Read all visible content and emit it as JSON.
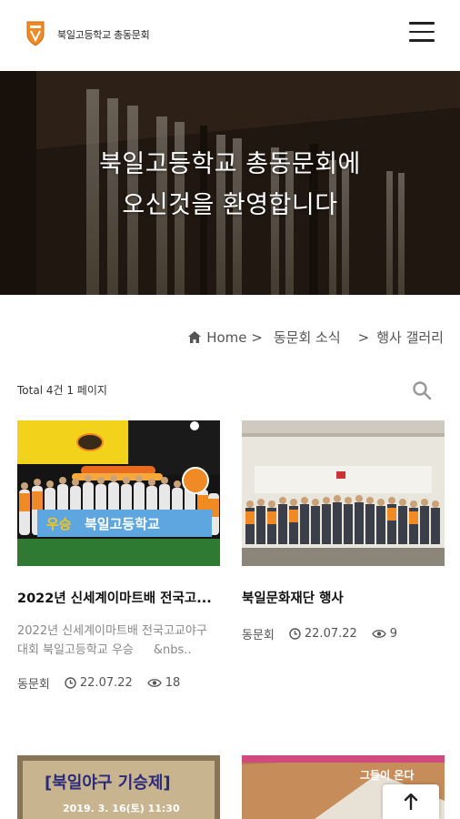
{
  "header": {
    "site_name": "북일고등학교 총동문회",
    "logo": "school-emblem",
    "menu_icon": "hamburger-menu-icon"
  },
  "hero": {
    "line1": "북일고등학교 총동문회에",
    "line2": "오신것을 환영합니다"
  },
  "breadcrumb": {
    "home": "Home >",
    "level1": "동문회 소식",
    "separator": ">",
    "level2": "행사 갤러리"
  },
  "list_info": {
    "total": "Total 4건 1 페이지"
  },
  "posts": [
    {
      "title": "2022년 신세계이마트배 전국고...",
      "excerpt_line1": "2022년 신세계이마트배 전국고교야구",
      "excerpt_line2": "대회 북일고등학교 우승",
      "excerpt_more": "&nbs..",
      "author": "동문회",
      "date": "22.07.22",
      "views": "18",
      "thumb_banner": "우승 북일고등학교"
    },
    {
      "title": "북일문화재단 행사",
      "author": "동문회",
      "date": "22.07.22",
      "views": "9"
    },
    {
      "thumb_text": "[북일야구 기승제]",
      "thumb_subtext": "2019. 3. 16(토) 11:30"
    },
    {
      "thumb_text": "그들이 온다"
    }
  ],
  "colors": {
    "brand_orange": "#f08a24",
    "text_dark": "#111111",
    "text_muted": "#888888"
  }
}
